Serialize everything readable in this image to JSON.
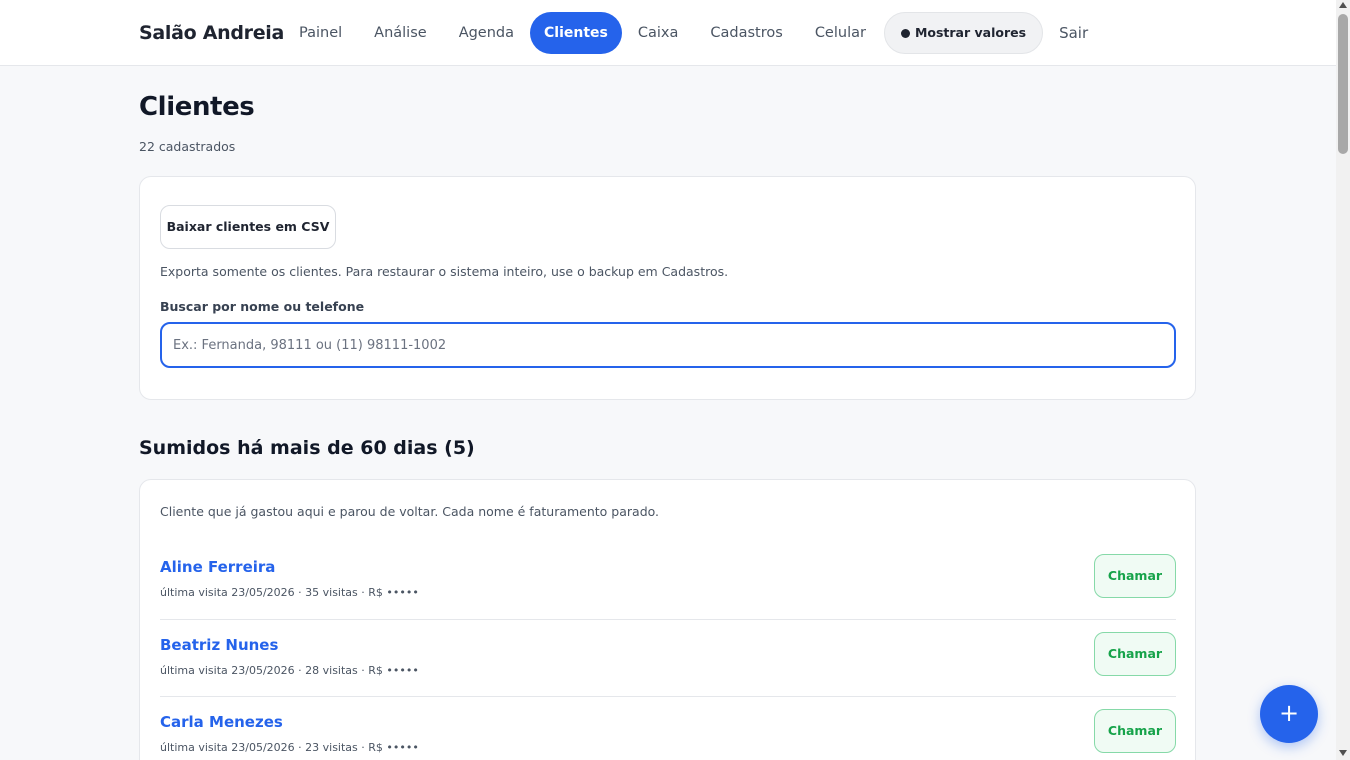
{
  "header": {
    "brand": "Salão Andreia",
    "nav": [
      {
        "label": "Painel",
        "active": false
      },
      {
        "label": "Análise",
        "active": false
      },
      {
        "label": "Agenda",
        "active": false
      },
      {
        "label": "Clientes",
        "active": true
      },
      {
        "label": "Caixa",
        "active": false
      },
      {
        "label": "Cadastros",
        "active": false
      },
      {
        "label": "Celular",
        "active": false
      }
    ],
    "show_values_label": "Mostrar valores",
    "exit_label": "Sair"
  },
  "page": {
    "title": "Clientes",
    "subtitle": "22 cadastrados"
  },
  "export": {
    "button_label": "Baixar clientes em CSV",
    "note": "Exporta somente os clientes. Para restaurar o sistema inteiro, use o backup em Cadastros."
  },
  "search": {
    "label": "Buscar por nome ou telefone",
    "value": "",
    "placeholder": "Ex.: Fernanda, 98111 ou (11) 98111-1002"
  },
  "inactive": {
    "title": "Sumidos há mais de 60 dias (5)",
    "note": "Cliente que já gastou aqui e parou de voltar. Cada nome é faturamento parado.",
    "clients": [
      {
        "name": "Aline Ferreira",
        "meta": "última visita 23/05/2026 · 35 visitas · R$ •••••",
        "action": "Chamar"
      },
      {
        "name": "Beatriz Nunes",
        "meta": "última visita 23/05/2026 · 28 visitas · R$ •••••",
        "action": "Chamar"
      },
      {
        "name": "Carla Menezes",
        "meta": "última visita 23/05/2026 · 23 visitas · R$ •••••",
        "action": "Chamar"
      }
    ]
  },
  "fab": {
    "label": "+"
  },
  "colors": {
    "accent": "#2563eb",
    "success": "#16a34a",
    "background": "#f7f8fa"
  }
}
